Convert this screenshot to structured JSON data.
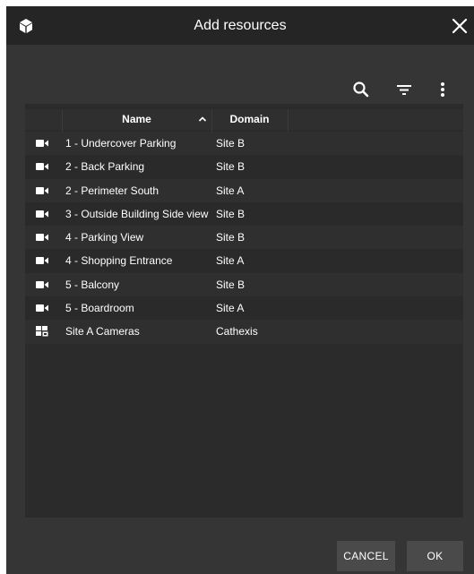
{
  "dialog": {
    "title": "Add resources",
    "icons": {
      "app": "cube-icon",
      "close": "close-icon",
      "search": "search-icon",
      "filter": "filter-icon",
      "more": "more-vertical-icon"
    }
  },
  "table": {
    "columns": [
      "Name",
      "Domain"
    ],
    "sort_column": "Name",
    "sort_direction": "ascending",
    "rows": [
      {
        "icon": "camera-icon",
        "name": "1 - Undercover Parking",
        "domain": "Site B"
      },
      {
        "icon": "camera-icon",
        "name": "2 - Back Parking",
        "domain": "Site B"
      },
      {
        "icon": "camera-icon",
        "name": "2 - Perimeter South",
        "domain": "Site A"
      },
      {
        "icon": "camera-icon",
        "name": "3 - Outside Building Side view",
        "domain": "Site B"
      },
      {
        "icon": "camera-icon",
        "name": "4 - Parking View",
        "domain": "Site B"
      },
      {
        "icon": "camera-icon",
        "name": "4 - Shopping Entrance",
        "domain": "Site A"
      },
      {
        "icon": "camera-icon",
        "name": "5 - Balcony",
        "domain": "Site B"
      },
      {
        "icon": "camera-icon",
        "name": "5 - Boardroom",
        "domain": "Site A"
      },
      {
        "icon": "camera-group-icon",
        "name": "Site A Cameras",
        "domain": "Cathexis"
      }
    ]
  },
  "footer": {
    "cancel_label": "CANCEL",
    "ok_label": "OK"
  },
  "colors": {
    "titlebar": "#252525",
    "body": "#353535",
    "table": "#2b2b2b",
    "button": "#4a4a4a",
    "text": "#ffffff"
  }
}
